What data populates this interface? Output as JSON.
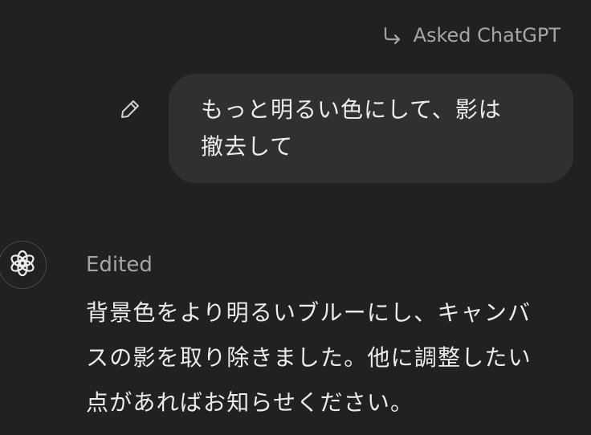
{
  "header": {
    "asked_label": "Asked ChatGPT",
    "asked_icon": "return-arrow-icon"
  },
  "user_message": {
    "text_line1": "もっと明るい色にして、影は",
    "text_line2": "撤去して",
    "edit_icon": "pencil-icon"
  },
  "assistant_message": {
    "avatar_icon": "openai-logo-icon",
    "status": "Edited",
    "line1": "背景色をより明るいブルーにし、キャンバ",
    "line2": "スの影を取り除きました。他に調整したい",
    "line3": "点があればお知らせください。"
  },
  "colors": {
    "background": "#212121",
    "bubble": "#303030",
    "text": "#ececec",
    "muted": "#a6a6a6"
  }
}
